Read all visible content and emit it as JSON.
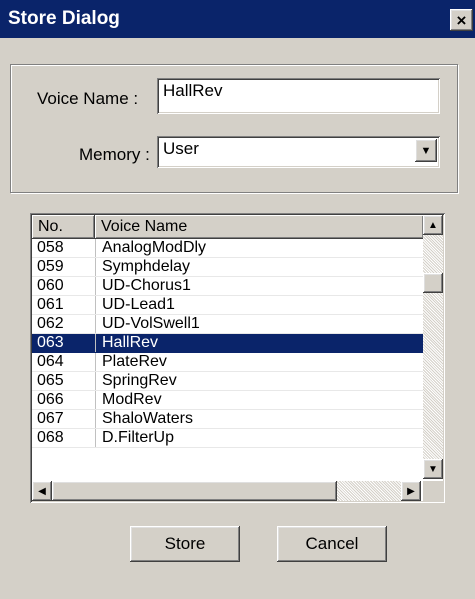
{
  "window": {
    "title": "Store Dialog",
    "close_icon": "close-icon"
  },
  "voice_name": {
    "label": "Voice Name :",
    "value": "HallRev"
  },
  "memory": {
    "label": "Memory :",
    "value": "User"
  },
  "list": {
    "columns": [
      "No.",
      "Voice Name"
    ],
    "rows": [
      {
        "no": "058",
        "name": "AnalogModDly"
      },
      {
        "no": "059",
        "name": "Symphdelay"
      },
      {
        "no": "060",
        "name": "UD-Chorus1"
      },
      {
        "no": "061",
        "name": "UD-Lead1"
      },
      {
        "no": "062",
        "name": "UD-VolSwell1"
      },
      {
        "no": "063",
        "name": "HallRev"
      },
      {
        "no": "064",
        "name": "PlateRev"
      },
      {
        "no": "065",
        "name": "SpringRev"
      },
      {
        "no": "066",
        "name": "ModRev"
      },
      {
        "no": "067",
        "name": "ShaloWaters"
      },
      {
        "no": "068",
        "name": "D.FilterUp"
      }
    ],
    "selected_no": "063"
  },
  "buttons": {
    "store": "Store",
    "cancel": "Cancel"
  },
  "colors": {
    "titlebar": "#0a246a",
    "face": "#d4d0c8",
    "selection": "#0a246a"
  }
}
